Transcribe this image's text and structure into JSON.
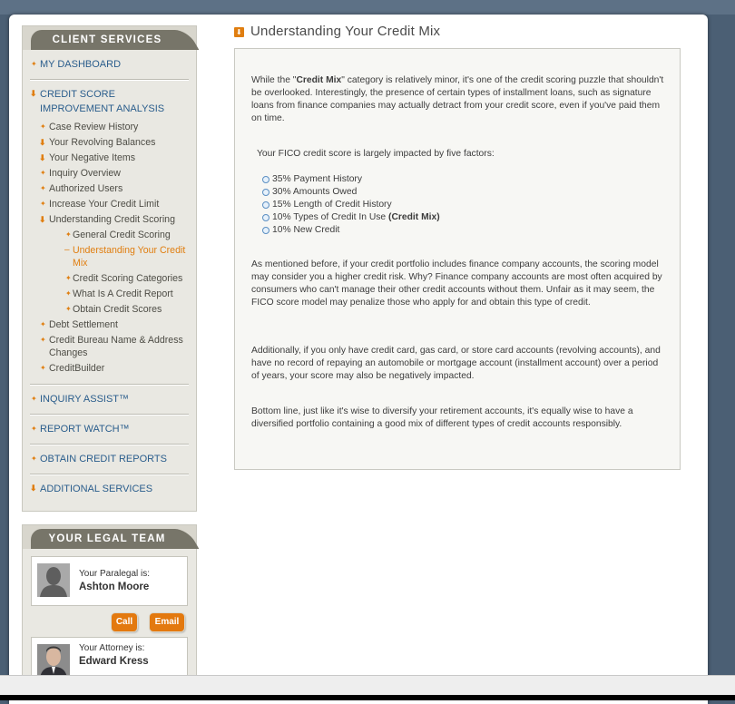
{
  "sidebar": {
    "client_services": {
      "title": "CLIENT SERVICES",
      "dashboard": "MY DASHBOARD",
      "improvement": "CREDIT SCORE IMPROVEMENT ANALYSIS",
      "items": [
        "Case Review History",
        "Your Revolving Balances",
        "Your Negative Items",
        "Inquiry Overview",
        "Authorized Users",
        "Increase Your Credit Limit",
        "Understanding Credit Scoring"
      ],
      "scoring_items": [
        "General Credit Scoring",
        "Understanding Your Credit Mix",
        "Credit Scoring Categories",
        "What Is A Credit Report",
        "Obtain Credit Scores"
      ],
      "after_items": [
        "Debt Settlement",
        "Credit Bureau Name & Address Changes",
        "CreditBuilder"
      ],
      "inquiry_assist": "INQUIRY ASSIST™",
      "report_watch": "REPORT WATCH™",
      "obtain_reports": "OBTAIN CREDIT REPORTS",
      "additional": "ADDITIONAL SERVICES"
    },
    "legal_team": {
      "title": "YOUR LEGAL TEAM",
      "paralegal_label": "Your Paralegal is:",
      "paralegal_name": "Ashton Moore",
      "call_label": "Call",
      "email_label": "Email",
      "attorney_label": "Your Attorney is:",
      "attorney_name": "Edward Kress"
    }
  },
  "main": {
    "title": "Understanding Your Credit Mix",
    "intro_pre": "While the \"",
    "intro_bold": "Credit Mix",
    "intro_post": "\" category is relatively minor, it's one of the credit scoring puzzle that shouldn't be overlooked. Interestingly, the presence of certain types of installment loans, such as signature loans from finance companies may actually detract from your credit score, even if you've paid them on time.",
    "factors_intro": "Your FICO credit score is largely impacted by five factors:",
    "factors": [
      "35% Payment History",
      "30% Amounts Owed",
      "15% Length of Credit History",
      "10% Types of Credit In Use",
      "10% New Credit"
    ],
    "factor_bold": "(Credit Mix)",
    "para2": "As mentioned before, if your credit portfolio includes finance company accounts, the scoring model may consider you a higher credit risk. Why? Finance company accounts are most often acquired by consumers who can't manage their other credit accounts without them. Unfair as it may seem, the FICO score model may penalize those who apply for and obtain this type of credit.",
    "para3": "Additionally, if you only have credit card, gas card, or store card accounts (revolving accounts), and have no record of repaying an automobile or mortgage account (installment account) over a period of years, your score may also be negatively impacted.",
    "para4": "Bottom line, just like it's wise to diversify your retirement accounts, it's equally wise to have a diversified portfolio containing a good mix of different types of credit accounts responsibly."
  },
  "colors": {
    "accent_orange": "#e07e10",
    "link_blue": "#2a5d8c",
    "tab_gray": "#777569",
    "sidebar_bg": "#e9e8e2"
  },
  "icons": {
    "expanded": "orange-down-arrow-icon",
    "collapsed": "orange-plus-icon",
    "current": "orange-dash-icon",
    "factor_bullet": "blue-circle-bullet-icon"
  }
}
